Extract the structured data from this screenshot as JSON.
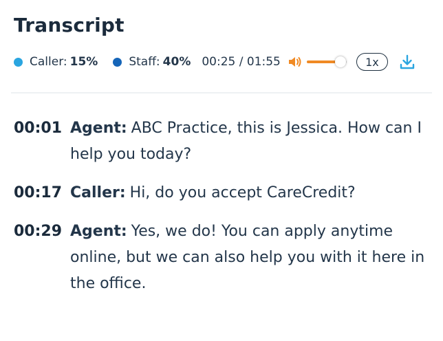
{
  "header": {
    "title": "Transcript"
  },
  "stats": {
    "caller_label": "Caller:",
    "caller_value": "15%",
    "caller_color": "#2aa5e0",
    "staff_label": "Staff:",
    "staff_value": "40%",
    "staff_color": "#1565b8"
  },
  "player": {
    "time": "00:25 / 01:55",
    "volume_level": 0.85,
    "volume_color": "#f08a24",
    "speed": "1x",
    "icons": {
      "volume": "volume-icon",
      "download": "download-icon"
    },
    "download_color": "#2aa5e0"
  },
  "transcript": [
    {
      "time": "00:01",
      "speaker": "Agent:",
      "text": "ABC Practice, this is Jessica. How can I help you today?"
    },
    {
      "time": "00:17",
      "speaker": "Caller:",
      "text": "Hi, do you accept CareCredit?"
    },
    {
      "time": "00:29",
      "speaker": "Agent:",
      "text": "Yes, we do! You can apply anytime online, but we can also help you with it here in the office."
    }
  ]
}
